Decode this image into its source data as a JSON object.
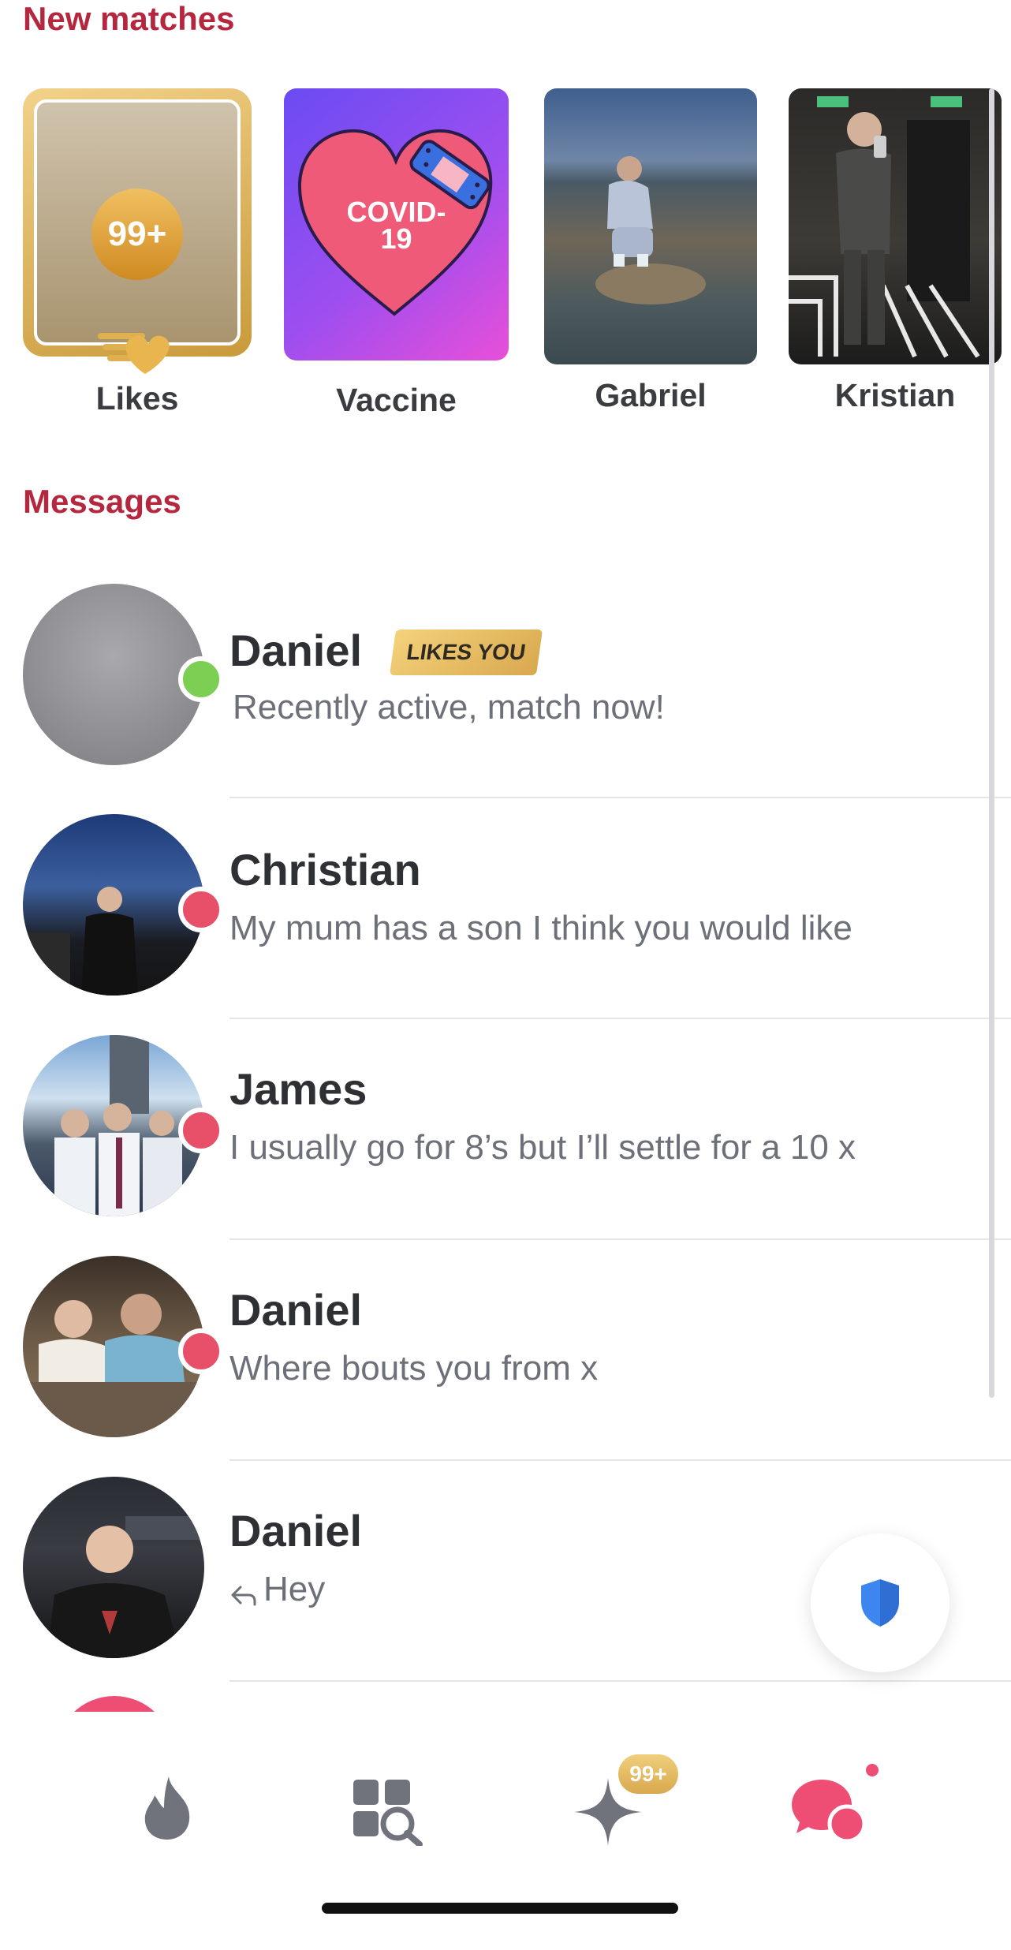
{
  "new_matches": {
    "title": "New matches",
    "items": [
      {
        "label": "Likes",
        "badge": "99+"
      },
      {
        "label": "Vaccine",
        "card_text": "COVID-\n19"
      },
      {
        "label": "Gabriel"
      },
      {
        "label": "Kristian"
      }
    ]
  },
  "messages": {
    "title": "Messages",
    "items": [
      {
        "name": "Daniel",
        "tag": "LIKES YOU",
        "text": "Recently active, match now!",
        "status": "online"
      },
      {
        "name": "Christian",
        "text": "My mum has a son I think you would like",
        "status": "unread"
      },
      {
        "name": "James",
        "text": "I usually go for 8’s but I’ll settle for a 10 x",
        "status": "unread"
      },
      {
        "name": "Daniel",
        "text": "Where bouts you from x",
        "status": "unread"
      },
      {
        "name": "Daniel",
        "text": "Hey",
        "replied_icon": "reply-arrow-icon"
      }
    ]
  },
  "nav": {
    "items": [
      {
        "icon": "flame-icon"
      },
      {
        "icon": "explore-grid-icon"
      },
      {
        "icon": "sparkle-icon",
        "badge": "99+"
      },
      {
        "icon": "chat-bubbles-icon"
      }
    ]
  },
  "colors": {
    "accent": "#b5273f",
    "online": "#7ccf52",
    "unread": "#e8506a",
    "gold": "#d8a84e",
    "shield": "#3d86f0"
  }
}
